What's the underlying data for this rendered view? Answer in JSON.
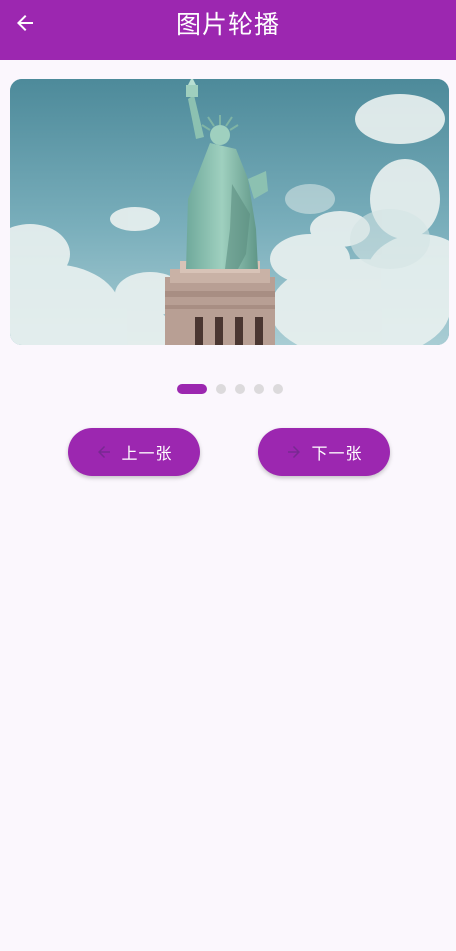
{
  "app_bar": {
    "title": "图片轮播",
    "back_icon": "arrow-back-icon",
    "color": "#9c27b0"
  },
  "carousel": {
    "image_subject": "statue-of-liberty-photo",
    "current_index": 0,
    "total": 5
  },
  "controls": {
    "prev_label": "上一张",
    "next_label": "下一张",
    "prev_icon": "arrow-left-icon",
    "next_icon": "arrow-right-icon"
  },
  "colors": {
    "accent": "#9c27b0",
    "background": "#fbf7fd",
    "dot_inactive": "#dcdadc"
  }
}
